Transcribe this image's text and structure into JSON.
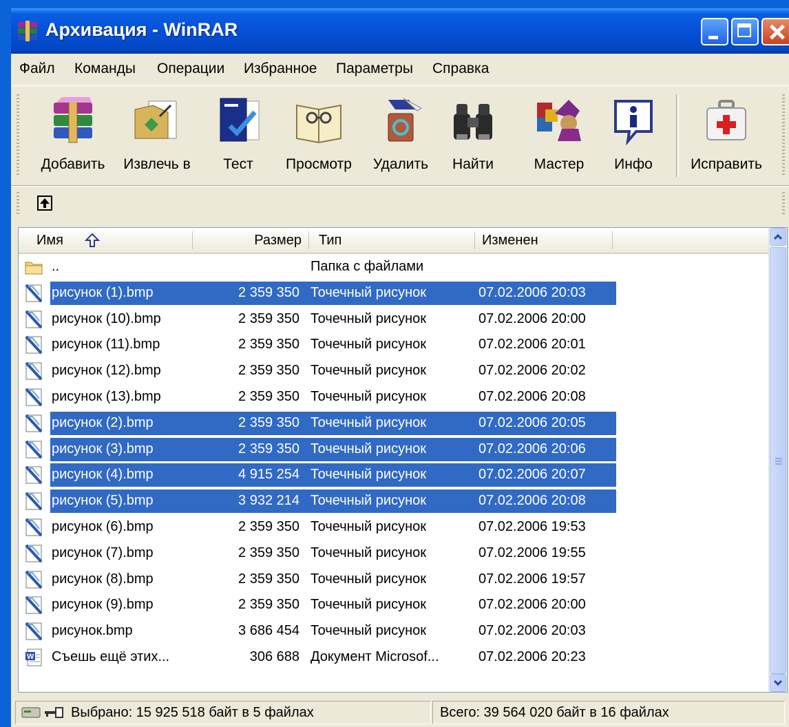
{
  "window": {
    "title": "Архивация - WinRAR"
  },
  "menu": [
    {
      "label": "Файл"
    },
    {
      "label": "Команды"
    },
    {
      "label": "Операции"
    },
    {
      "label": "Избранное"
    },
    {
      "label": "Параметры"
    },
    {
      "label": "Справка"
    }
  ],
  "toolbar": {
    "buttons": [
      {
        "label": "Добавить",
        "icon": "add-archive-icon"
      },
      {
        "label": "Извлечь в",
        "icon": "extract-to-icon"
      },
      {
        "label": "Тест",
        "icon": "test-icon"
      },
      {
        "label": "Просмотр",
        "icon": "view-icon"
      },
      {
        "label": "Удалить",
        "icon": "delete-icon"
      },
      {
        "label": "Найти",
        "icon": "find-icon"
      },
      {
        "label": "Мастер",
        "icon": "wizard-icon"
      },
      {
        "label": "Инфо",
        "icon": "info-icon"
      },
      {
        "label": "Исправить",
        "icon": "repair-icon"
      }
    ]
  },
  "list": {
    "columns": {
      "name": "Имя",
      "size": "Размер",
      "type": "Тип",
      "modified": "Изменен"
    },
    "rows": [
      {
        "name": "..",
        "size": "",
        "type": "Папка с файлами",
        "modified": "",
        "icon": "folder-icon",
        "selected": false
      },
      {
        "name": "рисунок (1).bmp",
        "size": "2 359 350",
        "type": "Точечный рисунок",
        "modified": "07.02.2006 20:03",
        "icon": "bitmap-file-icon",
        "selected": true
      },
      {
        "name": "рисунок (10).bmp",
        "size": "2 359 350",
        "type": "Точечный рисунок",
        "modified": "07.02.2006 20:00",
        "icon": "bitmap-file-icon",
        "selected": false
      },
      {
        "name": "рисунок (11).bmp",
        "size": "2 359 350",
        "type": "Точечный рисунок",
        "modified": "07.02.2006 20:01",
        "icon": "bitmap-file-icon",
        "selected": false
      },
      {
        "name": "рисунок (12).bmp",
        "size": "2 359 350",
        "type": "Точечный рисунок",
        "modified": "07.02.2006 20:02",
        "icon": "bitmap-file-icon",
        "selected": false
      },
      {
        "name": "рисунок (13).bmp",
        "size": "2 359 350",
        "type": "Точечный рисунок",
        "modified": "07.02.2006 20:08",
        "icon": "bitmap-file-icon",
        "selected": false
      },
      {
        "name": "рисунок (2).bmp",
        "size": "2 359 350",
        "type": "Точечный рисунок",
        "modified": "07.02.2006 20:05",
        "icon": "bitmap-file-icon",
        "selected": true
      },
      {
        "name": "рисунок (3).bmp",
        "size": "2 359 350",
        "type": "Точечный рисунок",
        "modified": "07.02.2006 20:06",
        "icon": "bitmap-file-icon",
        "selected": true
      },
      {
        "name": "рисунок (4).bmp",
        "size": "4 915 254",
        "type": "Точечный рисунок",
        "modified": "07.02.2006 20:07",
        "icon": "bitmap-file-icon",
        "selected": true
      },
      {
        "name": "рисунок (5).bmp",
        "size": "3 932 214",
        "type": "Точечный рисунок",
        "modified": "07.02.2006 20:08",
        "icon": "bitmap-file-icon",
        "selected": true
      },
      {
        "name": "рисунок (6).bmp",
        "size": "2 359 350",
        "type": "Точечный рисунок",
        "modified": "07.02.2006 19:53",
        "icon": "bitmap-file-icon",
        "selected": false
      },
      {
        "name": "рисунок (7).bmp",
        "size": "2 359 350",
        "type": "Точечный рисунок",
        "modified": "07.02.2006 19:55",
        "icon": "bitmap-file-icon",
        "selected": false
      },
      {
        "name": "рисунок (8).bmp",
        "size": "2 359 350",
        "type": "Точечный рисунок",
        "modified": "07.02.2006 19:57",
        "icon": "bitmap-file-icon",
        "selected": false
      },
      {
        "name": "рисунок (9).bmp",
        "size": "2 359 350",
        "type": "Точечный рисунок",
        "modified": "07.02.2006 20:00",
        "icon": "bitmap-file-icon",
        "selected": false
      },
      {
        "name": "рисунок.bmp",
        "size": "3 686 454",
        "type": "Точечный рисунок",
        "modified": "07.02.2006 20:03",
        "icon": "bitmap-file-icon",
        "selected": false
      },
      {
        "name": "Съешь ещё этих...",
        "size": "306 688",
        "type": "Документ Microsof...",
        "modified": "07.02.2006 20:23",
        "icon": "word-document-icon",
        "selected": false
      }
    ]
  },
  "status": {
    "selected": "Выбрано: 15 925 518 байт в 5 файлах",
    "total": "Всего: 39 564 020 байт в 16 файлах"
  },
  "colors": {
    "title_bar": "#0550d8",
    "selection": "#316ac5",
    "window_face": "#ece9d8",
    "desktop": "#0a64d8"
  }
}
